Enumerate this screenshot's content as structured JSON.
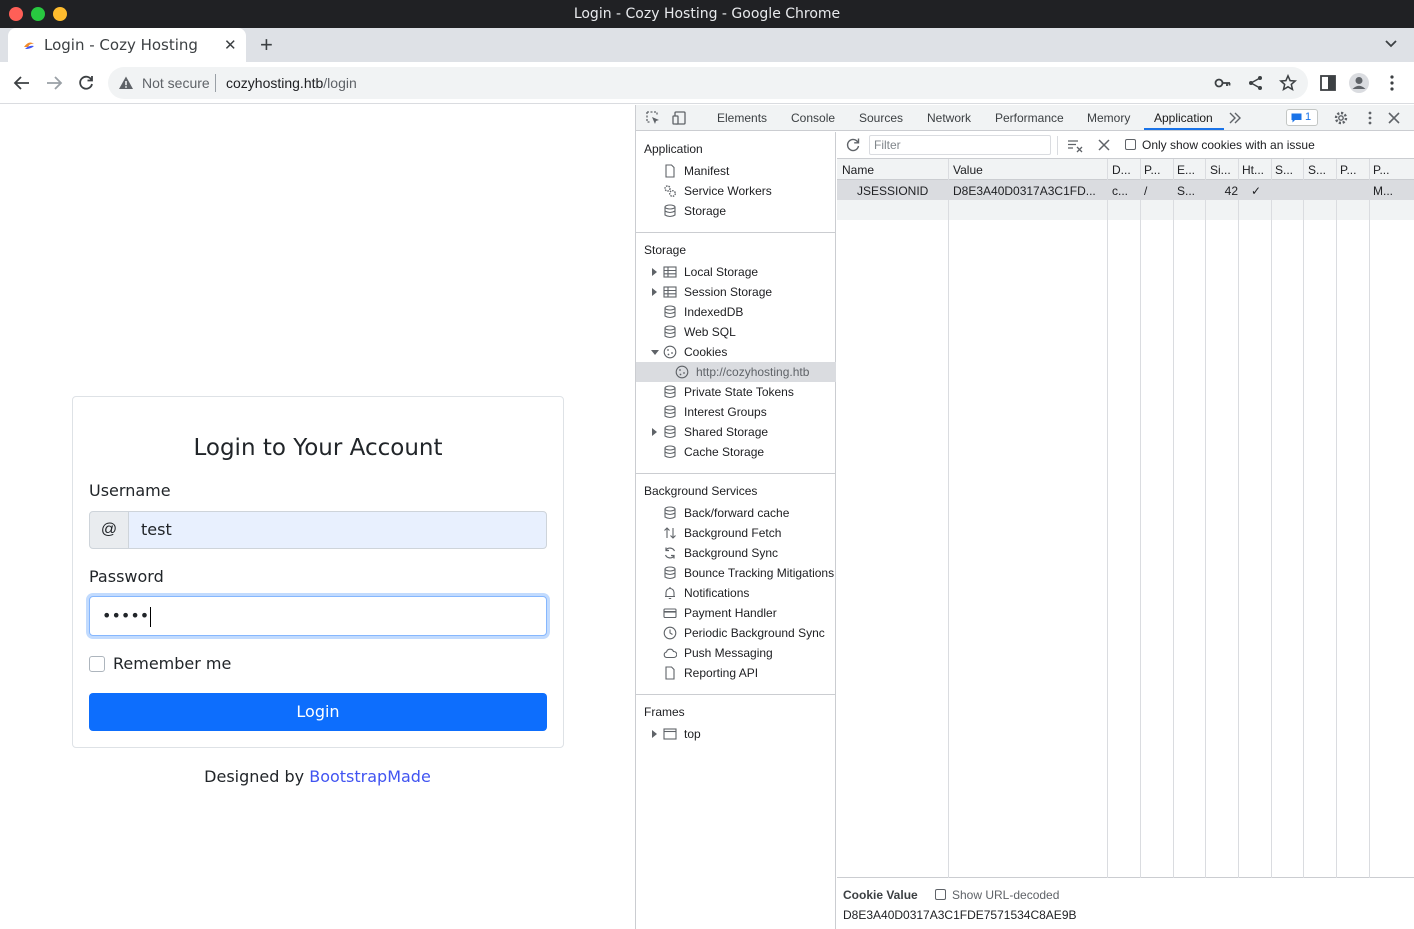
{
  "window": {
    "title": "Login - Cozy Hosting - Google Chrome"
  },
  "tab": {
    "title": "Login - Cozy Hosting",
    "close": "✕",
    "new": "+"
  },
  "address": {
    "security": "Not secure",
    "host": "cozyhosting.htb",
    "path": "/login"
  },
  "login": {
    "heading": "Login to Your Account",
    "username_label": "Username",
    "username_addon": "@",
    "username_value": "test",
    "password_label": "Password",
    "password_value": "•••••",
    "remember_label": "Remember me",
    "submit_label": "Login",
    "footer_prefix": "Designed by ",
    "footer_link": "BootstrapMade"
  },
  "devtools": {
    "tabs": [
      "Elements",
      "Console",
      "Sources",
      "Network",
      "Performance",
      "Memory",
      "Application"
    ],
    "active_tab": "Application",
    "issues_count": "1",
    "sidebar": {
      "application_title": "Application",
      "application_items": [
        "Manifest",
        "Service Workers",
        "Storage"
      ],
      "storage_title": "Storage",
      "storage_items": [
        "Local Storage",
        "Session Storage",
        "IndexedDB",
        "Web SQL",
        "Cookies",
        "http://cozyhosting.htb",
        "Private State Tokens",
        "Interest Groups",
        "Shared Storage",
        "Cache Storage"
      ],
      "background_title": "Background Services",
      "background_items": [
        "Back/forward cache",
        "Background Fetch",
        "Background Sync",
        "Bounce Tracking Mitigations",
        "Notifications",
        "Payment Handler",
        "Periodic Background Sync",
        "Push Messaging",
        "Reporting API"
      ],
      "frames_title": "Frames",
      "frames_items": [
        "top"
      ]
    },
    "cookies": {
      "filter_placeholder": "Filter",
      "only_issues_label": "Only show cookies with an issue",
      "columns": [
        "Name",
        "Value",
        "D...",
        "P...",
        "E...",
        "Si...",
        "Ht...",
        "S...",
        "S...",
        "P...",
        "P..."
      ],
      "row": [
        "JSESSIONID",
        "D8E3A40D0317A3C1FD...",
        "c...",
        "/",
        "S...",
        "42",
        "✓",
        "",
        "",
        "",
        "M..."
      ],
      "value_header": "Cookie Value",
      "show_decoded_label": "Show URL-decoded",
      "value_full": "D8E3A40D0317A3C1FDE7571534C8AE9B"
    }
  },
  "colors": {
    "primary_button": "#0d6efd",
    "link": "#4154f1",
    "devtools_accent": "#1a73e8",
    "traffic_close": "#ff5f57",
    "traffic_min": "#28c840",
    "traffic_max": "#febc2e"
  }
}
